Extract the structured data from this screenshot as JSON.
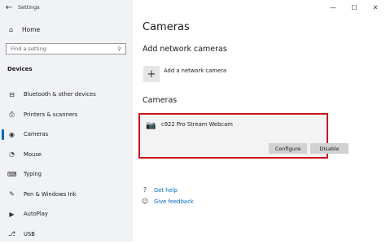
{
  "window": {
    "title": "Settings"
  },
  "window_controls": {
    "minimize": "—",
    "maximize": "☐",
    "close": "✕"
  },
  "sidebar": {
    "back_icon": "←",
    "home_label": "Home",
    "home_icon": "⌂",
    "search_placeholder": "Find a setting",
    "search_icon": "⚲",
    "section_title": "Devices",
    "items": [
      {
        "label": "Bluetooth & other devices",
        "icon": "⊟",
        "active": false
      },
      {
        "label": "Printers & scanners",
        "icon": "⎙",
        "active": false
      },
      {
        "label": "Cameras",
        "icon": "◉",
        "active": true
      },
      {
        "label": "Mouse",
        "icon": "◔",
        "active": false
      },
      {
        "label": "Typing",
        "icon": "⌨",
        "active": false
      },
      {
        "label": "Pen & Windows Ink",
        "icon": "✎",
        "active": false
      },
      {
        "label": "AutoPlay",
        "icon": "▶",
        "active": false
      },
      {
        "label": "USB",
        "icon": "⎇",
        "active": false
      }
    ]
  },
  "main": {
    "page_title": "Cameras",
    "network_heading": "Add network cameras",
    "add_icon": "+",
    "add_label": "Add a network camera",
    "cameras_heading": "Cameras",
    "camera": {
      "icon": "📷",
      "name": "c922 Pro Stream Webcam",
      "configure_label": "Configure",
      "disable_label": "Disable"
    },
    "help_links": [
      {
        "label": "Get help",
        "icon": "?"
      },
      {
        "label": "Give feedback",
        "icon": "☺"
      }
    ]
  },
  "colors": {
    "accent": "#0067c0",
    "highlight": "#c8161d",
    "sidebar_bg": "#f0f2f5"
  }
}
